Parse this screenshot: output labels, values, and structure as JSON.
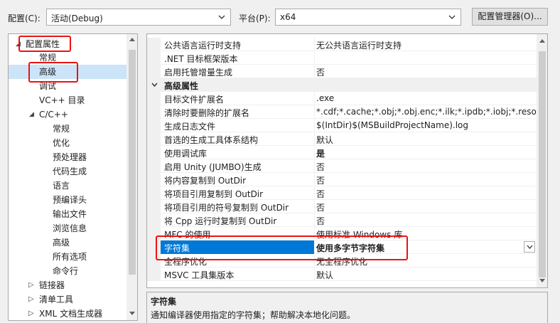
{
  "toolbar": {
    "config_label": "配置(C):",
    "config_value": "活动(Debug)",
    "platform_label": "平台(P):",
    "platform_value": "x64",
    "config_manager_label": "配置管理器(O)..."
  },
  "tree": {
    "root": "配置属性",
    "items": [
      {
        "label": "常规"
      },
      {
        "label": "高级"
      },
      {
        "label": "调试"
      },
      {
        "label": "VC++ 目录"
      },
      {
        "label": "C/C++"
      },
      {
        "label": "常规"
      },
      {
        "label": "优化"
      },
      {
        "label": "预处理器"
      },
      {
        "label": "代码生成"
      },
      {
        "label": "语言"
      },
      {
        "label": "预编译头"
      },
      {
        "label": "输出文件"
      },
      {
        "label": "浏览信息"
      },
      {
        "label": "高级"
      },
      {
        "label": "所有选项"
      },
      {
        "label": "命令行"
      },
      {
        "label": "链接器"
      },
      {
        "label": "清单工具"
      },
      {
        "label": "XML 文档生成器"
      }
    ]
  },
  "grid": {
    "rows": [
      {
        "name": "公共语言运行时支持",
        "value": "无公共语言运行时支持"
      },
      {
        "name": ".NET 目标框架版本",
        "value": ""
      },
      {
        "name": "启用托管增量生成",
        "value": "否"
      },
      {
        "name": "高级属性",
        "value": ""
      },
      {
        "name": "目标文件扩展名",
        "value": ".exe"
      },
      {
        "name": "清除时要删除的扩展名",
        "value": "*.cdf;*.cache;*.obj;*.obj.enc;*.ilk;*.ipdb;*.iobj;*.resources"
      },
      {
        "name": "生成日志文件",
        "value": "$(IntDir)$(MSBuildProjectName).log"
      },
      {
        "name": "首选的生成工具体系结构",
        "value": "默认"
      },
      {
        "name": "使用调试库",
        "value": "是"
      },
      {
        "name": "启用 Unity (JUMBO)生成",
        "value": "否"
      },
      {
        "name": "将内容复制到 OutDir",
        "value": "否"
      },
      {
        "name": "将项目引用复制到 OutDir",
        "value": "否"
      },
      {
        "name": "将项目引用的符号复制到 OutDir",
        "value": "否"
      },
      {
        "name": "将 Cpp 运行时复制到 OutDir",
        "value": "否"
      },
      {
        "name": "MFC 的使用",
        "value": "使用标准 Windows 库"
      },
      {
        "name": "字符集",
        "value": "使用多字节字符集"
      },
      {
        "name": "全程序优化",
        "value": "无全程序优化"
      },
      {
        "name": "MSVC 工具集版本",
        "value": "默认"
      }
    ]
  },
  "description": {
    "title": "字符集",
    "text": "通知编译器使用指定的字符集；帮助解决本地化问题。"
  },
  "colors": {
    "selection": "#0078d7",
    "tree_selection": "#cce4f7",
    "highlight_box": "#e11111"
  }
}
